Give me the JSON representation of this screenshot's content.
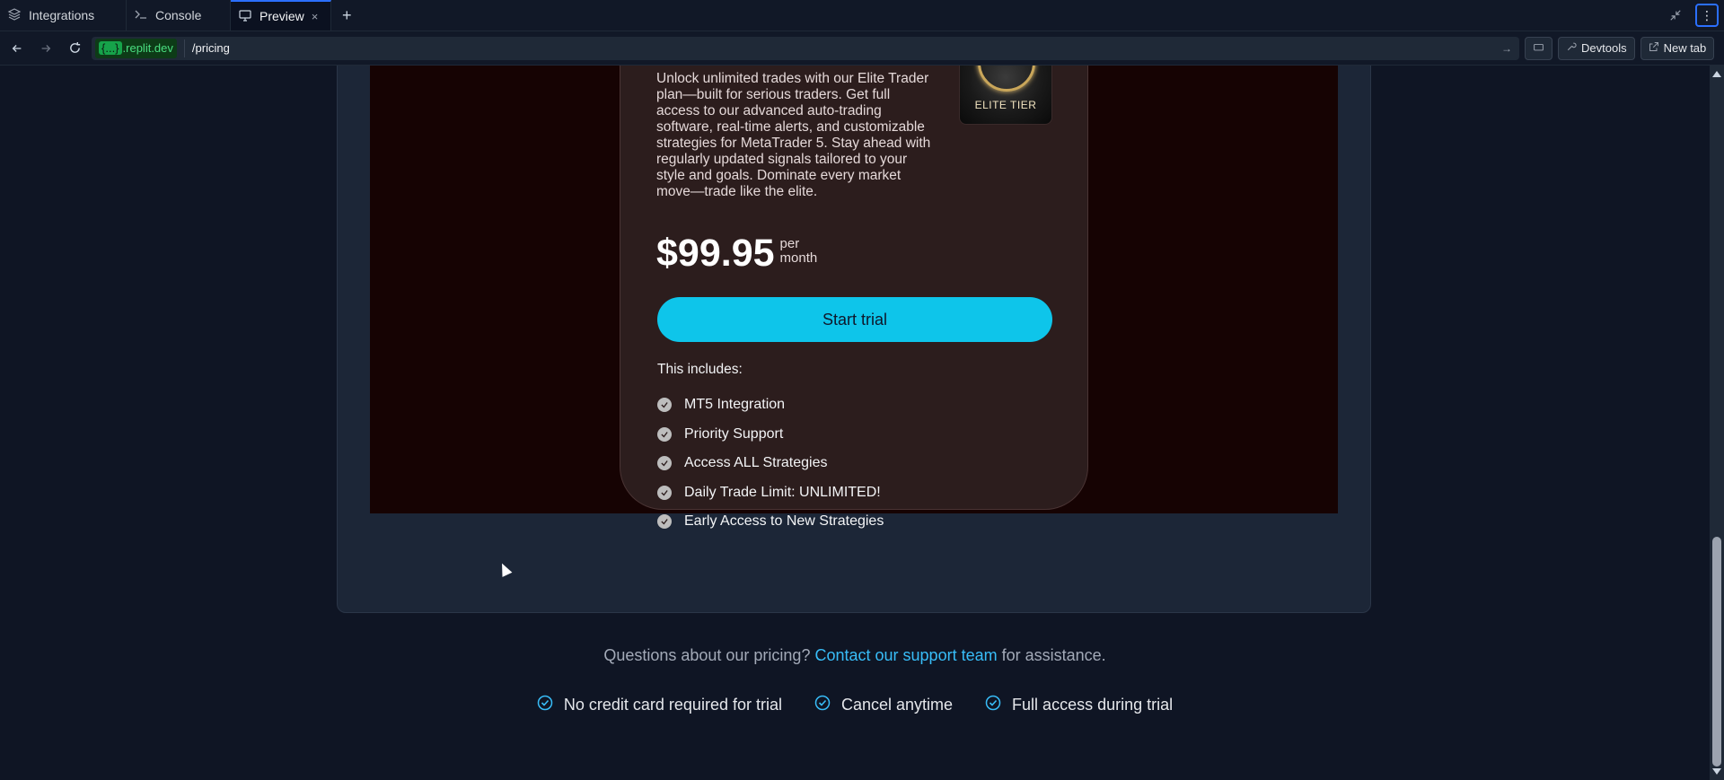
{
  "tabs": [
    {
      "label": "Integrations",
      "icon": "layers-icon"
    },
    {
      "label": "Console",
      "icon": "terminal-icon"
    },
    {
      "label": "Preview",
      "icon": "monitor-icon",
      "active": true,
      "close": "×"
    }
  ],
  "new_tab_symbol": "+",
  "address_bar": {
    "host_brace": "{...}",
    "host": ".replit.dev",
    "path": "/pricing",
    "devtools_label": "Devtools",
    "new_tab_label": "New tab"
  },
  "card": {
    "description": "Unlock unlimited trades with our Elite Trader plan—built for serious traders. Get full access to our advanced auto-trading software, real-time alerts, and customizable strategies for MetaTrader 5. Stay ahead with regularly updated signals tailored to your style and goals. Dominate every market move—trade like the elite.",
    "badge_text": "ELITE TIER",
    "price": "$99.95",
    "per_line1": "per",
    "per_line2": "month",
    "cta": "Start trial",
    "includes_label": "This includes:",
    "features": [
      "MT5 Integration",
      "Priority Support",
      "Access ALL Strategies",
      "Daily Trade Limit: UNLIMITED!",
      "Early Access to New Strategies"
    ]
  },
  "help": {
    "prefix": "Questions about our pricing?",
    "link": "Contact our support team",
    "suffix": "for assistance."
  },
  "perks": [
    "No credit card required for trial",
    "Cancel anytime",
    "Full access during trial"
  ],
  "colors": {
    "accent": "#0ec5ea",
    "link": "#38bdf8",
    "card_bg": "#2c1d1d",
    "page_bg": "#0f1524"
  }
}
